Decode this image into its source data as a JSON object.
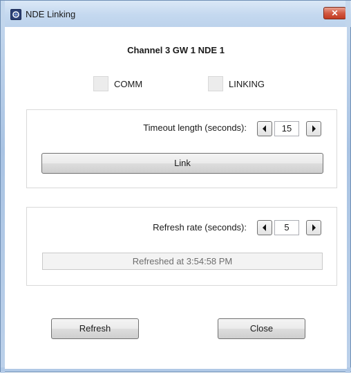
{
  "window": {
    "title": "NDE Linking",
    "close_glyph": "✕"
  },
  "header": {
    "text": "Channel 3  GW 1  NDE 1"
  },
  "indicators": [
    {
      "label": "COMM",
      "state": "off"
    },
    {
      "label": "LINKING",
      "state": "off"
    }
  ],
  "link_group": {
    "timeout_label": "Timeout length (seconds):",
    "timeout_value": "15",
    "link_button": "Link"
  },
  "refresh_group": {
    "rate_label": "Refresh rate (seconds):",
    "rate_value": "5",
    "status_text": "Refreshed at 3:54:58 PM"
  },
  "footer": {
    "refresh_button": "Refresh",
    "close_button": "Close"
  },
  "icons": {
    "app": "app-icon",
    "decrement": "left-arrow-icon",
    "increment": "right-arrow-icon"
  }
}
